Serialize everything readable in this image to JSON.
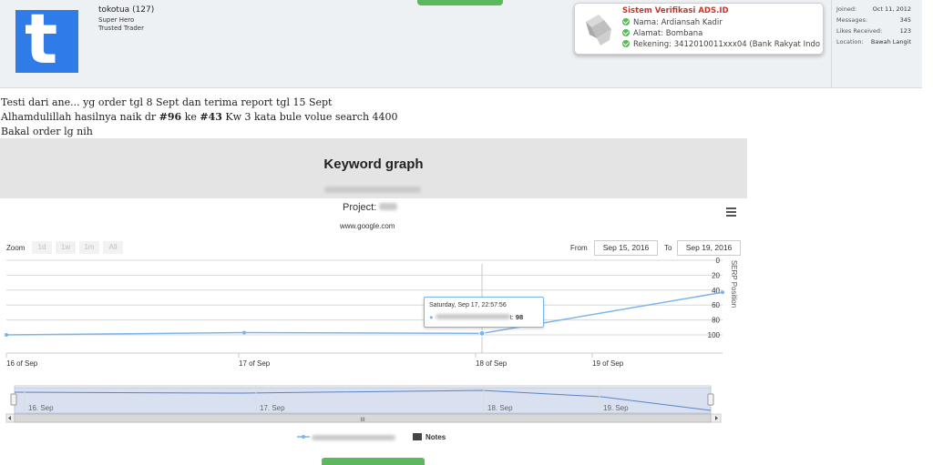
{
  "profile": {
    "username": "tokotua",
    "post_count": "(127)",
    "title_line1": "Super Hero",
    "title_line2": "Trusted Trader",
    "avatar_letter": "t",
    "avatar_color": "#2f7be8"
  },
  "verification": {
    "title": "Sistem Verifikasi ADS.ID",
    "nama": "Nama: Ardiansah Kadir",
    "alamat": "Alamat: Bombana",
    "rekening": "Rekening: 3412010011xxx04 (Bank Rakyat Indo"
  },
  "stats": [
    {
      "label": "Joined:",
      "value": "Oct 11, 2012"
    },
    {
      "label": "Messages:",
      "value": "345"
    },
    {
      "label": "Likes Received:",
      "value": "123"
    },
    {
      "label": "Location:",
      "value": "Bawah Langit"
    }
  ],
  "post": {
    "line1": "Testi dari ane... yg order tgl 8 Sept dan terima report tgl 15 Sept",
    "line2_a": "Alhamdulillah hasilnya naik dr ",
    "line2_b": "#96",
    "line2_c": " ke ",
    "line2_d": "#43",
    "line2_e": " Kw 3 kata bule volue search 4400",
    "line3": "Bakal order lg nih"
  },
  "graph": {
    "heading": "Keyword graph",
    "project_label": "Project:",
    "site": "www.google.com",
    "zoom_label": "Zoom",
    "zoom_buttons": [
      "1d",
      "1w",
      "1m",
      "All"
    ],
    "from_label": "From",
    "from_date": "Sep 15, 2016",
    "to_label": "To",
    "to_date": "Sep 19, 2016",
    "tooltip_date": "Saturday, Sep 17, 22:57:56",
    "tooltip_value": "98",
    "legend_notes": "Notes",
    "series_color": "#7cb5ec",
    "notes_color": "#434348",
    "navigator_labels": [
      "16. Sep",
      "17. Sep",
      "18. Sep",
      "19. Sep"
    ],
    "scrollbar_grip": "III"
  },
  "chart_data": {
    "type": "line",
    "ylabel": "SERP Position",
    "yticks": [
      "0",
      "20",
      "40",
      "60",
      "80",
      "100"
    ],
    "ylim": [
      100,
      0
    ],
    "y_inverted": true,
    "xticks": [
      "16 of Sep",
      "17 of Sep",
      "18 of Sep",
      "19 of Sep"
    ],
    "x": [
      "Sep 15 20:00",
      "Sep 16 20:00",
      "Sep 17 22:58",
      "Sep 19 20:00"
    ],
    "values": [
      100,
      97,
      98,
      43
    ],
    "grid": true
  }
}
